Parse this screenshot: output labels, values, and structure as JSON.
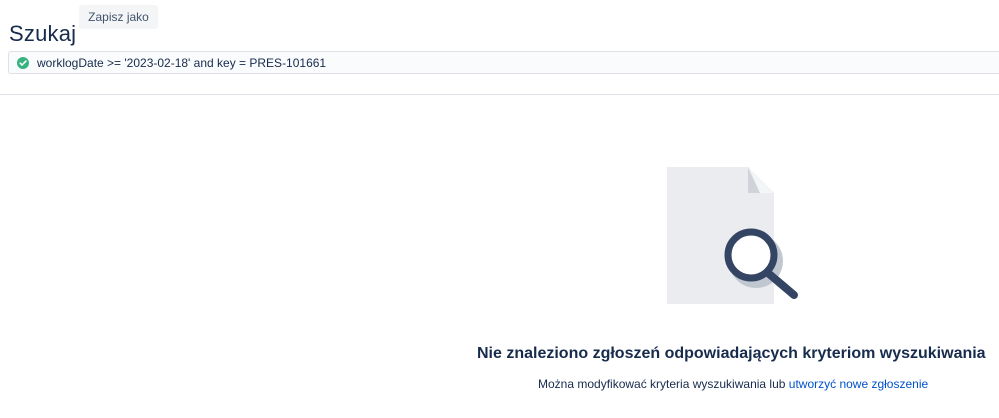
{
  "header": {
    "title": "Szukaj",
    "save_as_label": "Zapisz jako"
  },
  "search": {
    "query": "worklogDate >= '2023-02-18' and key = PRES-101661",
    "status_icon": "check-circle-icon",
    "status_color": "#36b37e"
  },
  "empty_state": {
    "illustration": "document-magnifier-icon",
    "title": "Nie znaleziono zgłoszeń odpowiadających kryteriom wyszukiwania",
    "description_prefix": "Można modyfikować kryteria wyszukiwania lub ",
    "create_link_label": "utworzyć nowe zgłoszenie"
  },
  "colors": {
    "text": "#172b4d",
    "link": "#0052cc",
    "button_bg": "#f4f5f7",
    "border": "#dfe1e6"
  }
}
